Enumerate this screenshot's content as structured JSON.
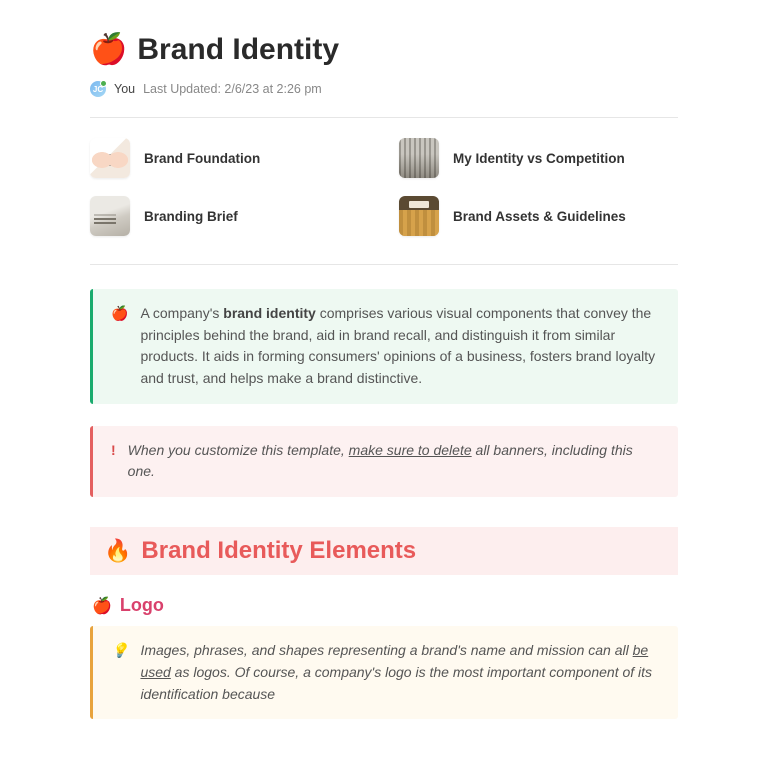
{
  "header": {
    "emoji": "🍎",
    "title": "Brand Identity",
    "avatar_initials": "JC",
    "author": "You",
    "updated_label": "Last Updated:",
    "updated_value": "2/6/23 at 2:26 pm"
  },
  "nav": {
    "items": [
      {
        "label": "Brand Foundation"
      },
      {
        "label": "My Identity vs Competition"
      },
      {
        "label": "Branding Brief"
      },
      {
        "label": "Brand Assets & Guidelines"
      }
    ]
  },
  "callouts": {
    "intro": {
      "icon": "🍎",
      "pre": "A company's ",
      "bold": "brand identity",
      "post": " comprises various visual components that convey the principles behind the brand, aid in brand recall, and distinguish it from similar products. It aids in forming consumers' opinions of a business, fosters brand loyalty and trust, and helps make a brand distinctive."
    },
    "warning": {
      "icon": "!",
      "pre": "When you customize this template, ",
      "underline": "make sure to delete",
      "post": " all banners, including this one."
    },
    "logo_tip": {
      "icon": "💡",
      "pre": "Images, phrases, and shapes representing a brand's name and mission can all ",
      "underline": "be used",
      "post": " as logos. Of course, a company's logo is the most important component of its identification because"
    }
  },
  "section": {
    "emoji": "🔥",
    "title": "Brand Identity Elements"
  },
  "subsection_logo": {
    "emoji": "🍎",
    "title": "Logo"
  }
}
